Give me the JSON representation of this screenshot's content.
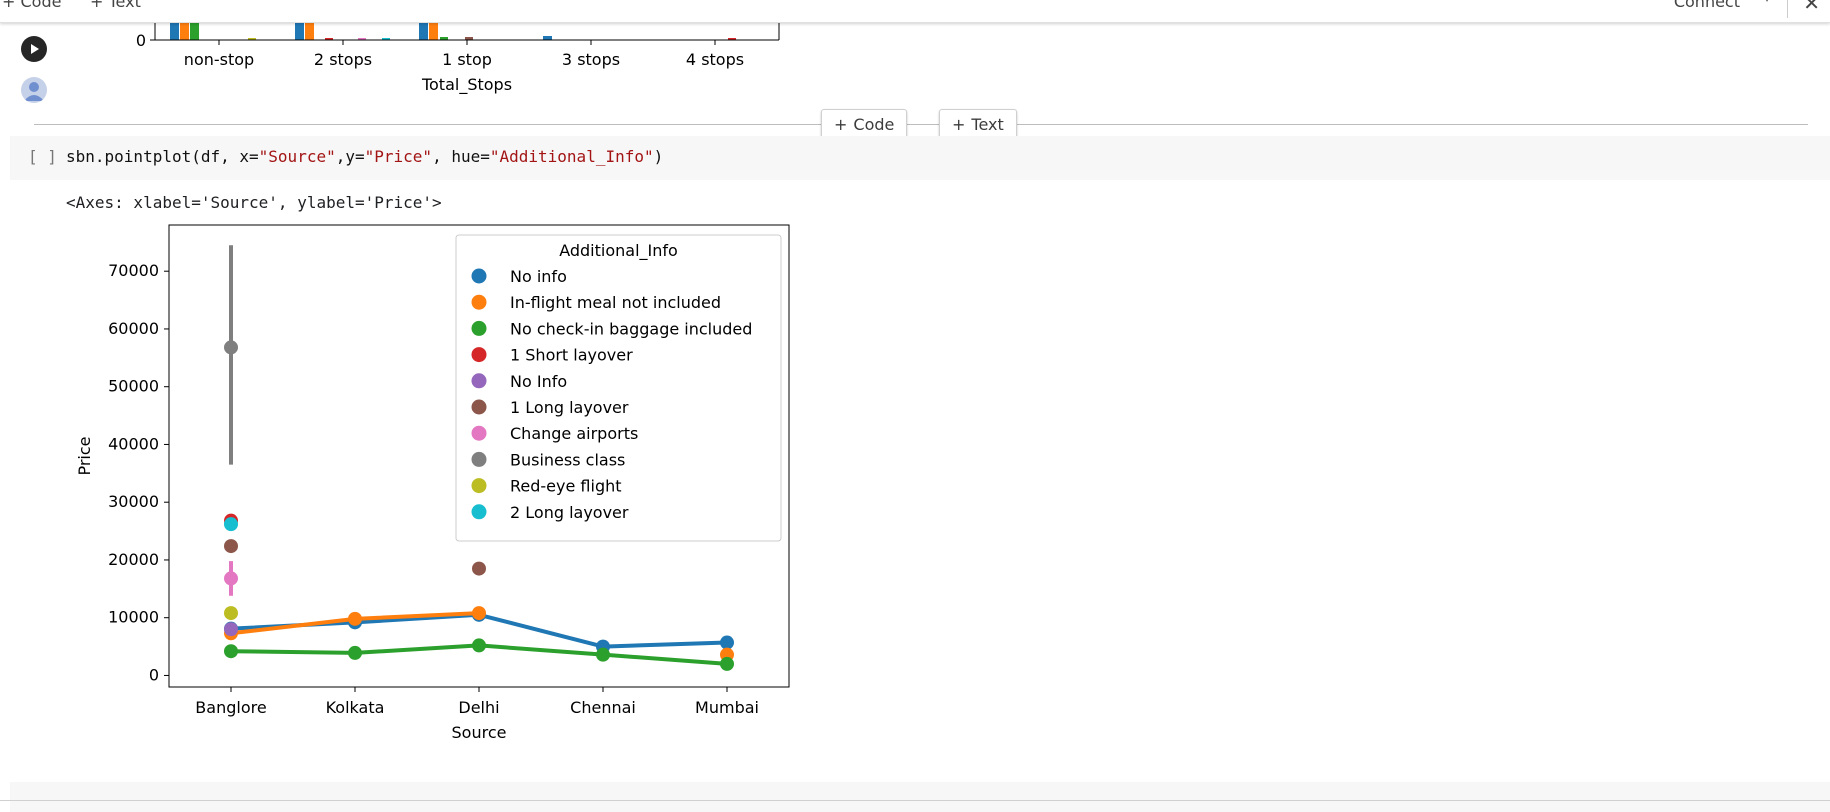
{
  "toolbar": {
    "code_label": "Code",
    "text_label": "Text",
    "connect_label": "Connect"
  },
  "prev_output": {
    "xlabel": "Total_Stops",
    "tick_labels": [
      "non-stop",
      "2 stops",
      "1 stop",
      "3 stops",
      "4 stops"
    ],
    "y_tick": "0"
  },
  "add_cell": {
    "code_label": "Code",
    "text_label": "Text"
  },
  "cell": {
    "exec_count": "[ ]",
    "code_prefix": "sbn.pointplot(df, x=",
    "x_arg": "\"Source\"",
    "y_sep": ",y=",
    "y_arg": "\"Price\"",
    "hue_sep": ", hue=",
    "hue_arg": "\"Additional_Info\"",
    "code_suffix": ")",
    "output_text": "<Axes: xlabel='Source', ylabel='Price'>"
  },
  "chart_data": {
    "type": "line",
    "xlabel": "Source",
    "ylabel": "Price",
    "categories": [
      "Banglore",
      "Kolkata",
      "Delhi",
      "Chennai",
      "Mumbai"
    ],
    "ylim": [
      -2000,
      78000
    ],
    "yticks": [
      0,
      10000,
      20000,
      30000,
      40000,
      50000,
      60000,
      70000
    ],
    "legend": {
      "title": "Additional_Info",
      "placement": "top-right"
    },
    "series": [
      {
        "name": "No info",
        "color": "#1f77b4",
        "values": [
          8100,
          9200,
          10500,
          5000,
          5700
        ]
      },
      {
        "name": "In-flight meal not included",
        "color": "#ff7f0e",
        "values": [
          7300,
          9800,
          10800,
          null,
          3600
        ]
      },
      {
        "name": "No check-in baggage included",
        "color": "#2ca02c",
        "values": [
          4200,
          3900,
          5200,
          3600,
          2000
        ]
      },
      {
        "name": "1 Short layover",
        "color": "#d62728",
        "values": [
          26800,
          null,
          null,
          null,
          null
        ]
      },
      {
        "name": "No Info",
        "color": "#9467bd",
        "values": [
          8000,
          null,
          null,
          null,
          null
        ]
      },
      {
        "name": "1 Long layover",
        "color": "#8c564b",
        "values": [
          22400,
          null,
          18500,
          null,
          null
        ]
      },
      {
        "name": "Change airports",
        "color": "#e377c2",
        "values": [
          16800,
          null,
          null,
          null,
          null
        ],
        "ci": [
          [
            13800,
            19800
          ],
          null,
          null,
          null,
          null
        ]
      },
      {
        "name": "Business class",
        "color": "#7f7f7f",
        "values": [
          56800,
          null,
          null,
          null,
          null
        ],
        "ci": [
          [
            36500,
            74500
          ],
          null,
          null,
          null,
          null
        ]
      },
      {
        "name": "Red-eye flight",
        "color": "#bcbd22",
        "values": [
          10800,
          null,
          null,
          null,
          null
        ]
      },
      {
        "name": "2 Long layover",
        "color": "#17becf",
        "values": [
          26200,
          null,
          null,
          null,
          null
        ]
      }
    ]
  }
}
